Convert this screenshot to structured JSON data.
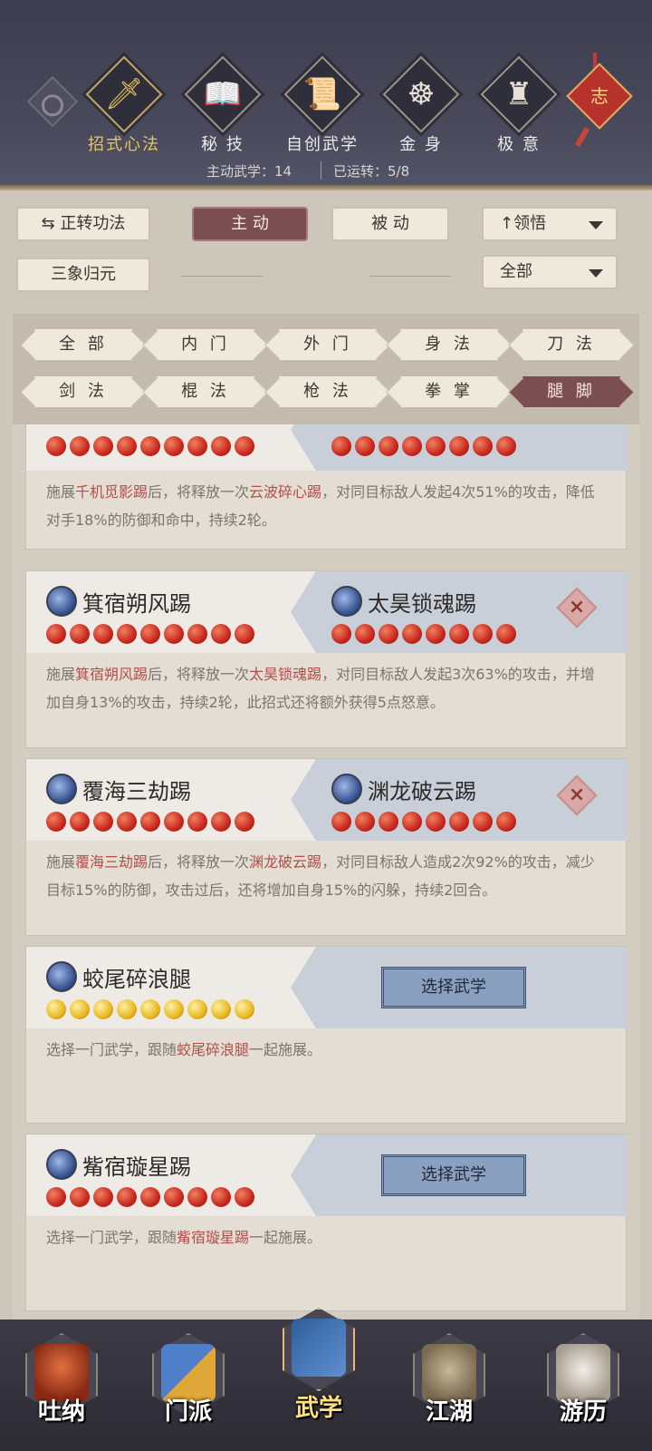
{
  "header": {
    "tabs": [
      {
        "label": "招式心法",
        "icon": "sword-icon",
        "active": true
      },
      {
        "label": "秘 技",
        "icon": "book-icon",
        "active": false
      },
      {
        "label": "自创武学",
        "icon": "scroll-icon",
        "active": false
      },
      {
        "label": "金 身",
        "icon": "meditation-icon",
        "active": false
      },
      {
        "label": "极 意",
        "icon": "martial-stance-icon",
        "active": false
      }
    ],
    "badge": "志",
    "stats": {
      "active_label": "主动武学：14",
      "running_label": "已运转：5/8"
    }
  },
  "controls": {
    "zhengzhuan": "正转功法",
    "zhudong": "主 动",
    "beidong": "被 动",
    "sort_label": "领悟",
    "sanxiang": "三象归元",
    "filter_label": "全部"
  },
  "chips": [
    "全 部",
    "内 门",
    "外 门",
    "身 法",
    "刀 法",
    "剑 法",
    "棍 法",
    "枪 法",
    "拳 掌",
    "腿 脚"
  ],
  "active_chip": "腿 脚",
  "cards": [
    {
      "left": "",
      "right": "",
      "desc_pre": "施展",
      "hl1": "千机觅影踢",
      "mid": "后，将释放一次",
      "hl2": "云波碎心踢",
      "post": "，对同目标敌人发起4次51%的攻击，降低对手18%的防御和命中，持续2轮。"
    },
    {
      "left": "箕宿朔风踢",
      "right": "太昊锁魂踢",
      "desc_pre": "施展",
      "hl1": "箕宿朔风踢",
      "mid": "后，将释放一次",
      "hl2": "太昊锁魂踢",
      "post": "，对同目标敌人发起3次63%的攻击，并增加自身13%的攻击，持续2轮，此招式还将额外获得5点怒意。"
    },
    {
      "left": "覆海三劫踢",
      "right": "渊龙破云踢",
      "desc_pre": "施展",
      "hl1": "覆海三劫踢",
      "mid": "后，将释放一次",
      "hl2": "渊龙破云踢",
      "post": "，对同目标敌人造成2次92%的攻击，减少目标15%的防御，攻击过后，还将增加自身15%的闪躲，持续2回合。"
    },
    {
      "left": "蛟尾碎浪腿",
      "choose": "选择武学",
      "desc_pre": "选择一门武学，跟随",
      "hl1": "蛟尾碎浪腿",
      "post": "一起施展。"
    },
    {
      "left": "觜宿璇星踢",
      "choose": "选择武学",
      "desc_pre": "选择一门武学，跟随",
      "hl1": "觜宿璇星踢",
      "post": "一起施展。"
    }
  ],
  "bottom_nav": [
    {
      "label": "吐纳",
      "active": false
    },
    {
      "label": "门派",
      "active": false
    },
    {
      "label": "武学",
      "active": true
    },
    {
      "label": "江湖",
      "active": false
    },
    {
      "label": "游历",
      "active": false
    }
  ]
}
